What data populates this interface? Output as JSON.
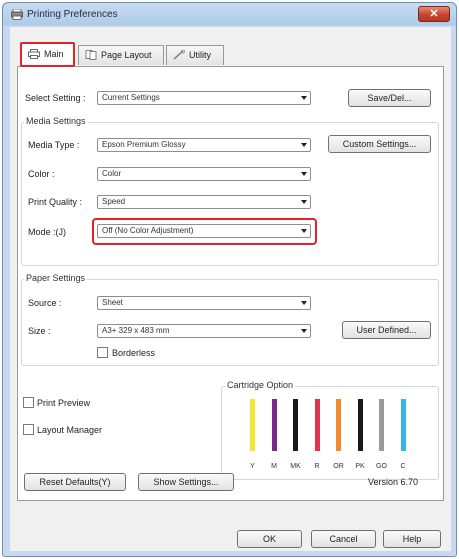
{
  "window": {
    "title": "Printing Preferences",
    "close_glyph": "✕"
  },
  "tabs": [
    {
      "label": "Main",
      "icon": "printer-icon"
    },
    {
      "label": "Page Layout",
      "icon": "page-layout-icon"
    },
    {
      "label": "Utility",
      "icon": "utility-icon"
    }
  ],
  "select_setting": {
    "label": "Select Setting :",
    "value": "Current Settings",
    "save_del_label": "Save/Del..."
  },
  "media_settings": {
    "title": "Media Settings",
    "media_type_label": "Media Type :",
    "media_type_value": "Epson Premium Glossy",
    "custom_settings_label": "Custom Settings...",
    "color_label": "Color :",
    "color_value": "Color",
    "print_quality_label": "Print Quality :",
    "print_quality_value": "Speed",
    "mode_label": "Mode :(J)",
    "mode_value": "Off (No Color Adjustment)"
  },
  "paper_settings": {
    "title": "Paper Settings",
    "source_label": "Source :",
    "source_value": "Sheet",
    "size_label": "Size :",
    "size_value": "A3+ 329 x 483 mm",
    "user_defined_label": "User Defined...",
    "borderless_label": "Borderless",
    "borderless_checked": false
  },
  "options": {
    "print_preview_label": "Print Preview",
    "print_preview_checked": false,
    "layout_manager_label": "Layout Manager",
    "layout_manager_checked": false
  },
  "cartridge_option": {
    "title": "Cartridge Option",
    "inks": [
      {
        "code": "Y",
        "color": "#f3e536"
      },
      {
        "code": "M",
        "color": "#7a2a8c"
      },
      {
        "code": "MK",
        "color": "#1a1a1a"
      },
      {
        "code": "R",
        "color": "#e2344a"
      },
      {
        "code": "OR",
        "color": "#f08a2c"
      },
      {
        "code": "PK",
        "color": "#1a1a1a"
      },
      {
        "code": "GO",
        "color": "#9a9a9a"
      },
      {
        "code": "C",
        "color": "#35b6e5"
      }
    ]
  },
  "footer": {
    "reset_defaults_label": "Reset Defaults(Y)",
    "show_settings_label": "Show Settings...",
    "version_label": "Version 6.70"
  },
  "dialog_buttons": {
    "ok_label": "OK",
    "cancel_label": "Cancel",
    "help_label": "Help"
  },
  "colors": {
    "highlight": "#e1232e",
    "titlebar": "#aecbe8"
  }
}
